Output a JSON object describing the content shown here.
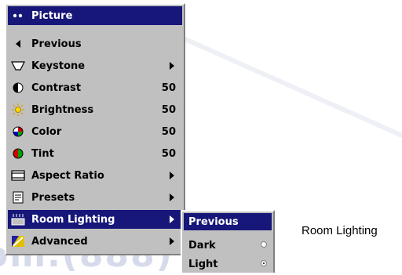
{
  "menu": {
    "title": "Picture",
    "items": [
      {
        "label": "Previous"
      },
      {
        "label": "Keystone"
      },
      {
        "label": "Contrast",
        "value": "50"
      },
      {
        "label": "Brightness",
        "value": "50"
      },
      {
        "label": "Color",
        "value": "50"
      },
      {
        "label": "Tint",
        "value": "50"
      },
      {
        "label": "Aspect Ratio"
      },
      {
        "label": "Presets"
      },
      {
        "label": "Room Lighting"
      },
      {
        "label": "Advanced"
      }
    ]
  },
  "submenu": {
    "items": [
      {
        "label": "Previous"
      },
      {
        "label": "Dark"
      },
      {
        "label": "Light"
      }
    ]
  },
  "caption": "Room Lighting",
  "colors": {
    "highlight": "#17177a",
    "menu_bg": "#c0c0c0"
  }
}
